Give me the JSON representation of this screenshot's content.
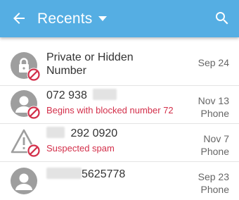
{
  "appbar": {
    "title": "Recents",
    "back_icon": "arrow-left-icon",
    "dropdown_icon": "caret-down-icon",
    "search_icon": "search-icon",
    "background": "#55aee3"
  },
  "calls": [
    {
      "name": "Private or Hidden Number",
      "subtitle": "",
      "date": "Sep 24",
      "type": "",
      "avatar_icon": "lock-person-icon",
      "badge_icon": "blocked-icon"
    },
    {
      "name": "072 938",
      "subtitle": "Begins with blocked number 72",
      "date": "Nov 13",
      "type": "Phone",
      "avatar_icon": "person-icon",
      "badge_icon": "blocked-icon"
    },
    {
      "name": "292 0920",
      "subtitle": "Suspected spam",
      "date": "Nov 7",
      "type": "Phone",
      "avatar_icon": "warning-icon",
      "badge_icon": "blocked-icon"
    },
    {
      "name": "5625778",
      "subtitle": "",
      "date": "Sep 23",
      "type": "Phone",
      "avatar_icon": "person-icon",
      "badge_icon": ""
    }
  ],
  "colors": {
    "accent": "#55aee3",
    "warning_text": "#d32f4a",
    "block_badge": "#d32f4a"
  }
}
